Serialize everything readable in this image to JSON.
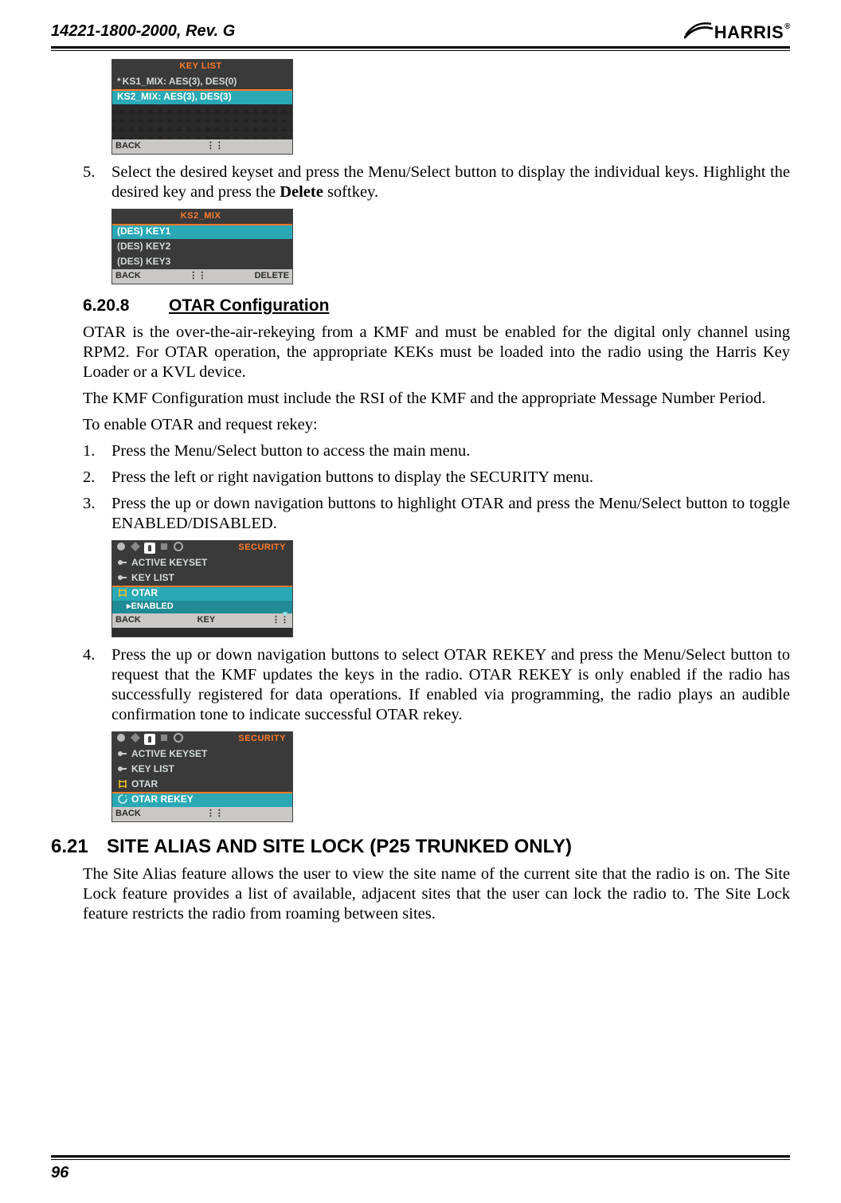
{
  "header": {
    "doc_id": "14221-1800-2000, Rev. G",
    "brand": "HARRIS",
    "reg_mark": "®"
  },
  "screens": {
    "keylist": {
      "title": "KEY LIST",
      "row1": "KS1_MIX: AES(3), DES(0)",
      "row2": "KS2_MIX: AES(3), DES(3)",
      "back": "BACK"
    },
    "ks2": {
      "title": "KS2_MIX",
      "k1": "(DES) KEY1",
      "k2": "(DES) KEY2",
      "k3": "(DES) KEY3",
      "back": "BACK",
      "delete": "DELETE"
    },
    "otar_enabled": {
      "title": "SECURITY",
      "r1": "ACTIVE KEYSET",
      "r2": "KEY LIST",
      "r3": "OTAR",
      "sub": "▸ENABLED",
      "back": "BACK",
      "mid": "KEY"
    },
    "otar_rekey": {
      "title": "SECURITY",
      "r1": "ACTIVE KEYSET",
      "r2": "KEY LIST",
      "r3": "OTAR",
      "r4": "OTAR REKEY",
      "back": "BACK"
    }
  },
  "steps": {
    "s5": "Select the desired keyset and press the Menu/Select button to display the individual keys. Highlight the desired key and press the ",
    "s5b": " softkey.",
    "delete_word": "Delete",
    "o1": "Press the Menu/Select button to access the main menu.",
    "o2": "Press the left or right navigation buttons to display the SECURITY menu.",
    "o3": "Press the up or down navigation buttons to highlight OTAR and press the Menu/Select button to toggle ENABLED/DISABLED.",
    "o4": "Press the up or down navigation buttons to select OTAR REKEY and press the Menu/Select button to request that the KMF updates the keys in the radio.  OTAR REKEY is only enabled if the radio has successfully registered for data operations.  If enabled via programming, the radio plays an audible confirmation tone to indicate successful OTAR rekey."
  },
  "sections": {
    "s6208_num": "6.20.8",
    "s6208_title": "OTAR Configuration",
    "s621_num": "6.21",
    "s621_title": "SITE ALIAS AND SITE LOCK (P25 TRUNKED ONLY)"
  },
  "paras": {
    "otar_p1": "OTAR is the over-the-air-rekeying from a KMF and must be enabled for the digital only channel using RPM2. For OTAR operation, the appropriate KEKs must be loaded into the radio using the Harris Key Loader or a KVL device.",
    "otar_p2": "The KMF Configuration must include the RSI of the KMF and the appropriate Message Number Period.",
    "otar_p3": "To enable OTAR and request rekey:",
    "site_p1": "The Site Alias feature allows the user to view the site name of the current site that the radio is on. The Site Lock feature provides a list of available, adjacent sites that the user can lock the radio to. The Site Lock feature restricts the radio from roaming between sites."
  },
  "nums": {
    "n5": "5.",
    "n1": "1.",
    "n2": "2.",
    "n3": "3.",
    "n4": "4."
  },
  "footer": {
    "page": "96"
  }
}
